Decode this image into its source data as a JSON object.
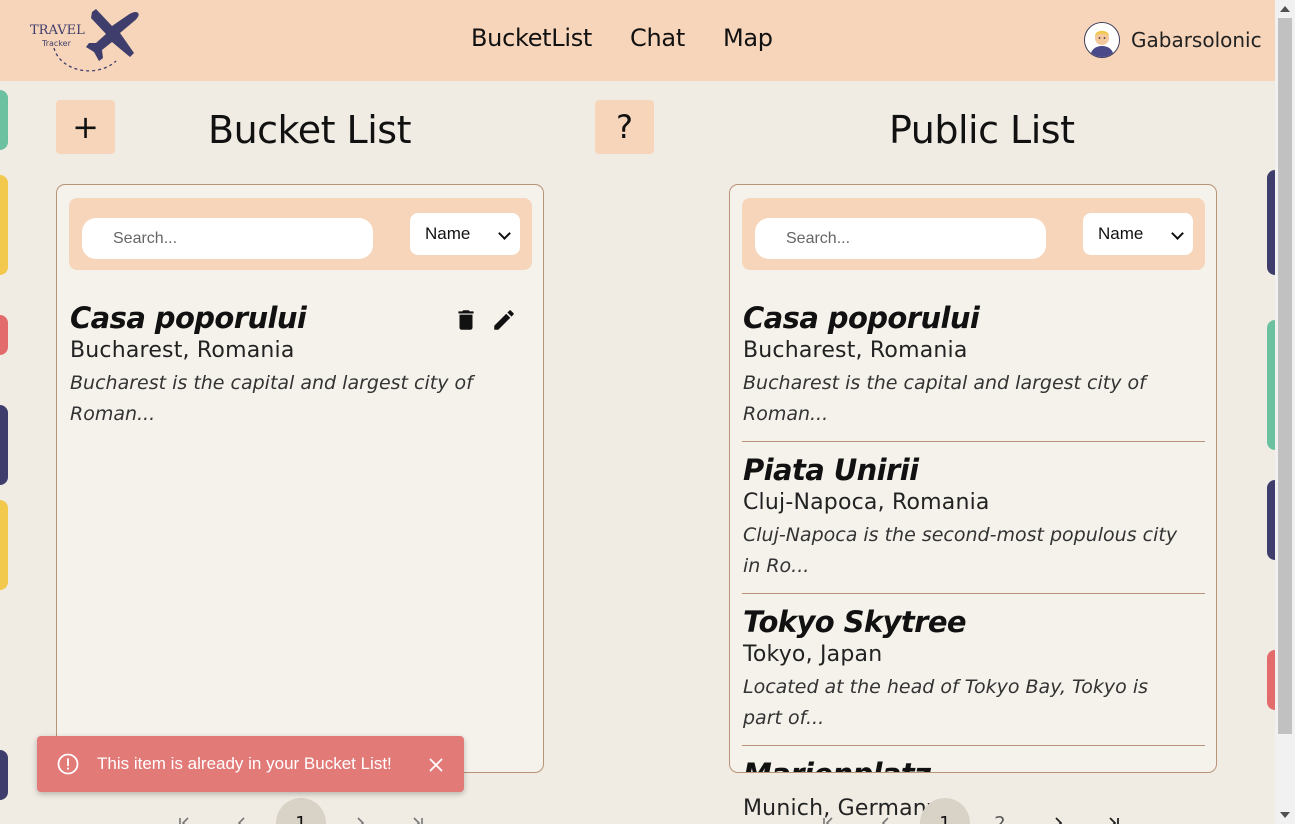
{
  "header": {
    "logo": {
      "line1": "TRAVEL",
      "line2": "Tracker"
    },
    "nav": [
      {
        "label": "BucketList"
      },
      {
        "label": "Chat"
      },
      {
        "label": "Map"
      }
    ],
    "user": {
      "name": "Gabarsolonic"
    }
  },
  "controls": {
    "add_label": "+",
    "help_label": "?"
  },
  "bucket_list": {
    "title": "Bucket List",
    "search_placeholder": "Search...",
    "sort_value": "Name",
    "items": [
      {
        "name": "Casa poporului",
        "location": "Bucharest, Romania",
        "description": "Bucharest is the capital and largest city of Roman..."
      }
    ],
    "pagination": {
      "current_page": "1"
    }
  },
  "public_list": {
    "title": "Public List",
    "search_placeholder": "Search...",
    "sort_value": "Name",
    "items": [
      {
        "name": "Casa poporului",
        "location": "Bucharest, Romania",
        "description": "Bucharest is the capital and largest city of Roman..."
      },
      {
        "name": "Piata Unirii",
        "location": "Cluj-Napoca, Romania",
        "description": "Cluj-Napoca is the second-most populous city in Ro..."
      },
      {
        "name": "Tokyo Skytree",
        "location": "Tokyo, Japan",
        "description": "Located at the head of Tokyo Bay, Tokyo is part of..."
      },
      {
        "name": "Marienplatz",
        "location": "Munich, Germany",
        "description": ""
      }
    ],
    "pagination": {
      "pages": [
        "1",
        "2"
      ],
      "current_page": "1"
    }
  },
  "toast": {
    "message": "This item is already in your Bucket List!"
  },
  "colors": {
    "header_bg": "#f6d5ba",
    "page_bg": "#f0ece4",
    "panel_border": "#b99378",
    "toast_bg": "#e27a78",
    "logo_navy": "#3f3d6b"
  },
  "icons": {
    "logo": "airplane-icon",
    "item_actions": [
      "trash-icon",
      "pencil-icon"
    ],
    "toast": "alert-circle-icon",
    "toast_close": "close-icon"
  }
}
